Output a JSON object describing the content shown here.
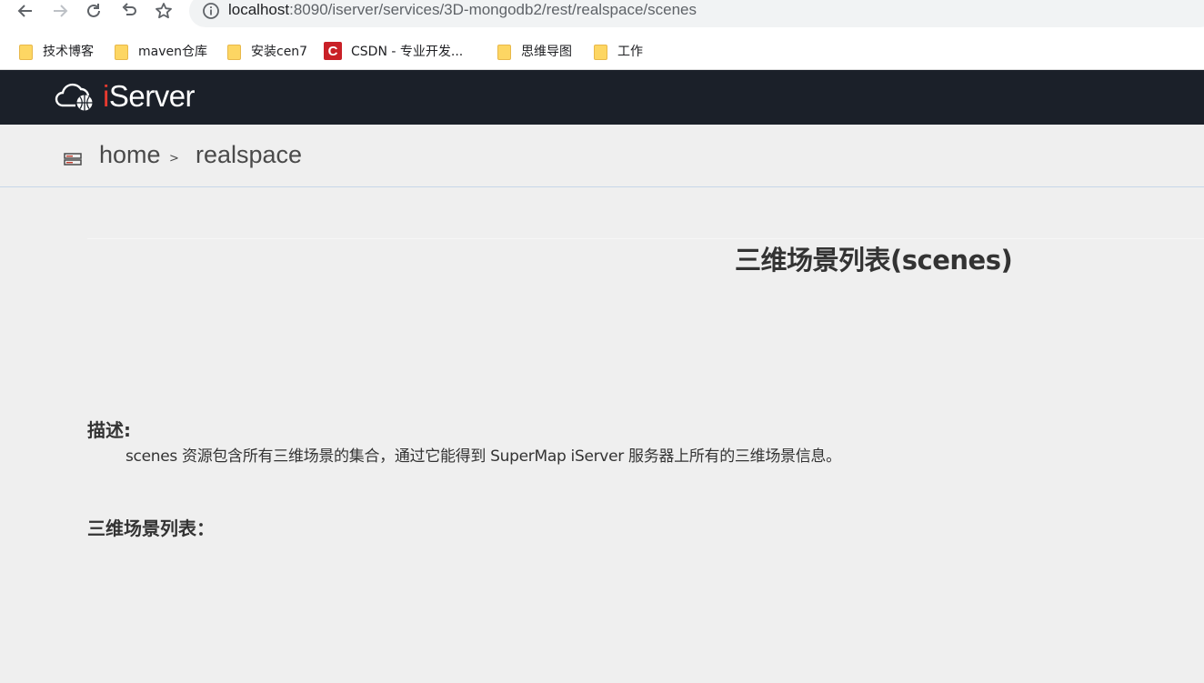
{
  "browser": {
    "url_host": "localhost",
    "url_rest": ":8090/iserver/services/3D-mongodb2/rest/realspace/scenes"
  },
  "bookmarks": [
    {
      "label": "技术博客",
      "icon": "folder-icon"
    },
    {
      "label": "maven仓库",
      "icon": "folder-icon"
    },
    {
      "label": "安装cen7",
      "icon": "folder-icon"
    },
    {
      "label": "CSDN - 专业开发...",
      "icon": "csdn-icon",
      "icon_text": "C"
    },
    {
      "label": "思维导图",
      "icon": "folder-icon"
    },
    {
      "label": "工作",
      "icon": "folder-icon"
    }
  ],
  "header": {
    "logo_i": "i",
    "logo_rest": "Server"
  },
  "breadcrumb": {
    "home": "home",
    "separator": ">",
    "current": "realspace"
  },
  "main": {
    "title": "三维场景列表(scenes)",
    "description_label": "描述:",
    "description_text": "scenes 资源包含所有三维场景的集合，通过它能得到 SuperMap iServer 服务器上所有的三维场景信息。",
    "list_label": "三维场景列表："
  },
  "colors": {
    "header_bg": "#1b2029",
    "page_bg": "#efefef",
    "logo_accent": "#e83a2f"
  }
}
